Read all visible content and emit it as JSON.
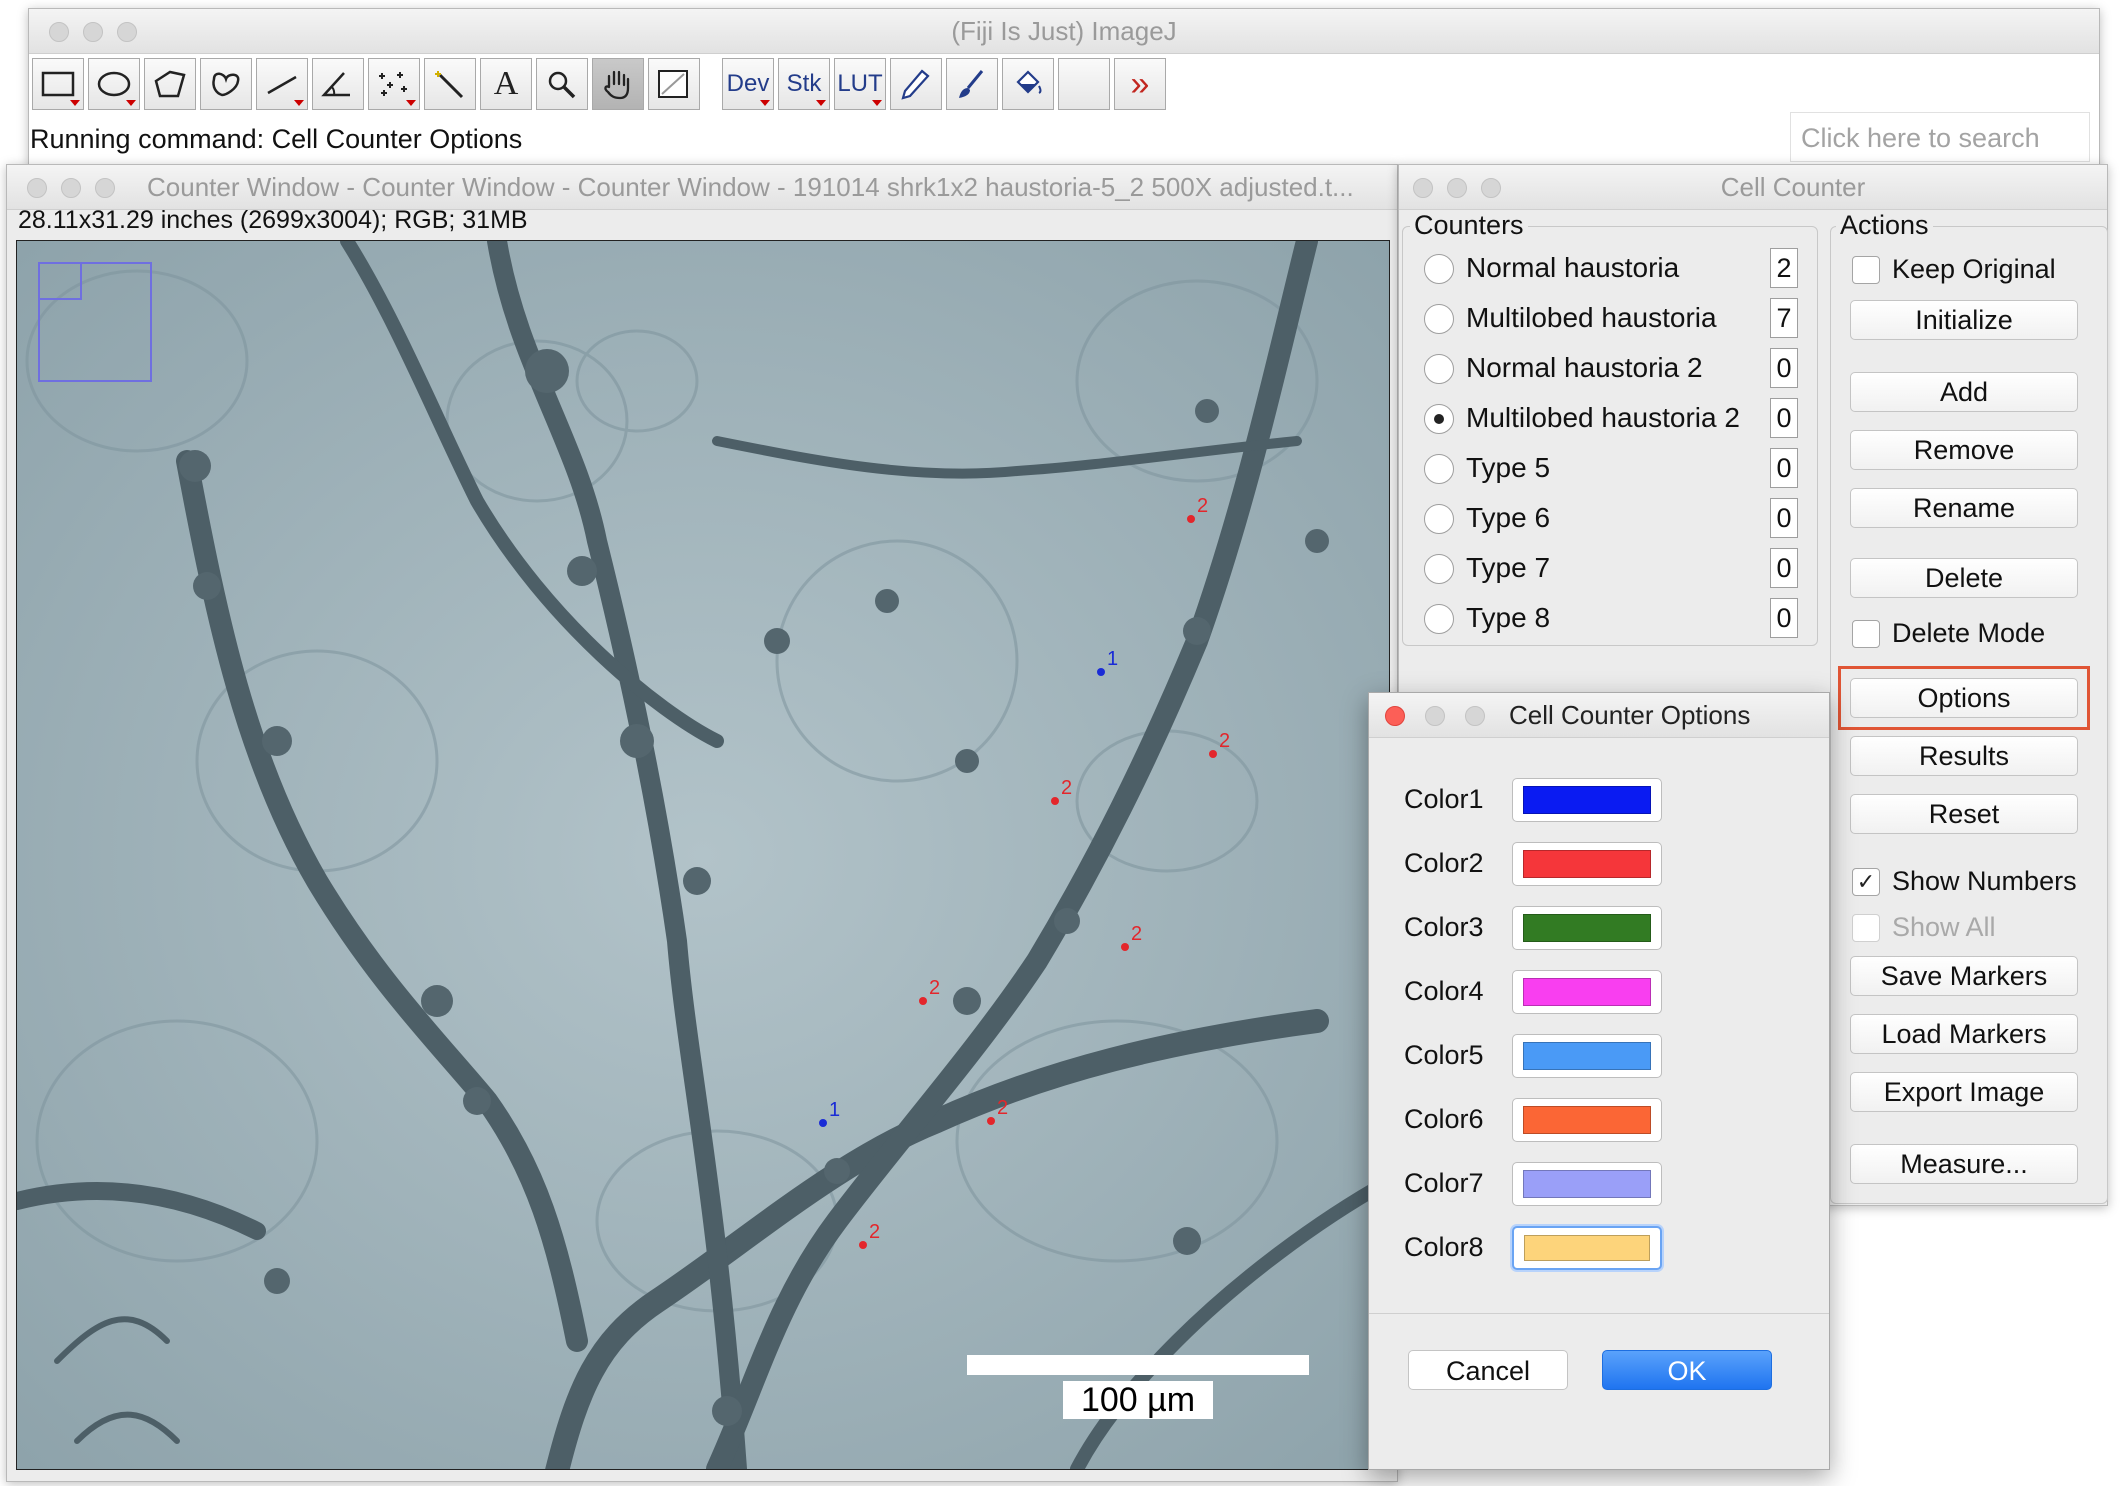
{
  "imagej": {
    "title": "(Fiji Is Just) ImageJ",
    "status": "Running command: Cell Counter Options",
    "search_placeholder": "Click here to search",
    "tools": {
      "rectangle": "rectangle-tool-icon",
      "oval": "oval-tool-icon",
      "polygon": "polygon-tool-icon",
      "freehand": "freehand-tool-icon",
      "line": "line-tool-icon",
      "angle": "angle-tool-icon",
      "multipoint": "multipoint-tool-icon",
      "wand": "wand-tool-icon",
      "text": "A",
      "magnifier": "magnifier-icon",
      "hand": "hand-tool-icon",
      "color_picker": "color-picker-icon",
      "dev": "Dev",
      "stk": "Stk",
      "lut": "LUT",
      "pencil": "pencil-icon",
      "brush": "brush-icon",
      "flood": "flood-fill-icon",
      "more": "»"
    }
  },
  "counter_window": {
    "title": "Counter Window - Counter Window - Counter Window - 191014 shrk1x2 haustoria-5_2 500X adjusted.t...",
    "info": "28.11x31.29 inches (2699x3004); RGB; 31MB",
    "scale_bar": "100 µm",
    "markers": [
      {
        "label": "1",
        "color": "#1a2bd6"
      },
      {
        "label": "1",
        "color": "#1a2bd6"
      },
      {
        "label": "2",
        "color": "#e3262b"
      },
      {
        "label": "2",
        "color": "#e3262b"
      },
      {
        "label": "2",
        "color": "#e3262b"
      },
      {
        "label": "2",
        "color": "#e3262b"
      },
      {
        "label": "2",
        "color": "#e3262b"
      },
      {
        "label": "2",
        "color": "#e3262b"
      },
      {
        "label": "2",
        "color": "#e3262b"
      }
    ]
  },
  "cell_counter": {
    "title": "Cell Counter",
    "counters_label": "Counters",
    "actions_label": "Actions",
    "counters": [
      {
        "name": "Normal haustoria",
        "count": "2",
        "selected": false
      },
      {
        "name": "Multilobed haustoria",
        "count": "7",
        "selected": false
      },
      {
        "name": "Normal haustoria 2",
        "count": "0",
        "selected": false
      },
      {
        "name": "Multilobed haustoria 2",
        "count": "0",
        "selected": true
      },
      {
        "name": "Type 5",
        "count": "0",
        "selected": false
      },
      {
        "name": "Type 6",
        "count": "0",
        "selected": false
      },
      {
        "name": "Type 7",
        "count": "0",
        "selected": false
      },
      {
        "name": "Type 8",
        "count": "0",
        "selected": false
      }
    ],
    "keep_original": "Keep Original",
    "initialize": "Initialize",
    "add": "Add",
    "remove": "Remove",
    "rename": "Rename",
    "delete": "Delete",
    "delete_mode": "Delete Mode",
    "options": "Options",
    "results": "Results",
    "reset": "Reset",
    "show_numbers": "Show Numbers",
    "show_numbers_checked": true,
    "show_all": "Show All",
    "save_markers": "Save Markers",
    "load_markers": "Load Markers",
    "export_image": "Export Image",
    "measure": "Measure...",
    "checkmark": "✓"
  },
  "options_dialog": {
    "title": "Cell Counter Options",
    "colors": [
      {
        "label": "Color1",
        "hex": "#0a1bf2"
      },
      {
        "label": "Color2",
        "hex": "#f5363a"
      },
      {
        "label": "Color3",
        "hex": "#327b23"
      },
      {
        "label": "Color4",
        "hex": "#f93ef0"
      },
      {
        "label": "Color5",
        "hex": "#4a9af6"
      },
      {
        "label": "Color6",
        "hex": "#fb6635"
      },
      {
        "label": "Color7",
        "hex": "#9a9ff8"
      },
      {
        "label": "Color8",
        "hex": "#fdd47b"
      }
    ],
    "cancel": "Cancel",
    "ok": "OK"
  }
}
